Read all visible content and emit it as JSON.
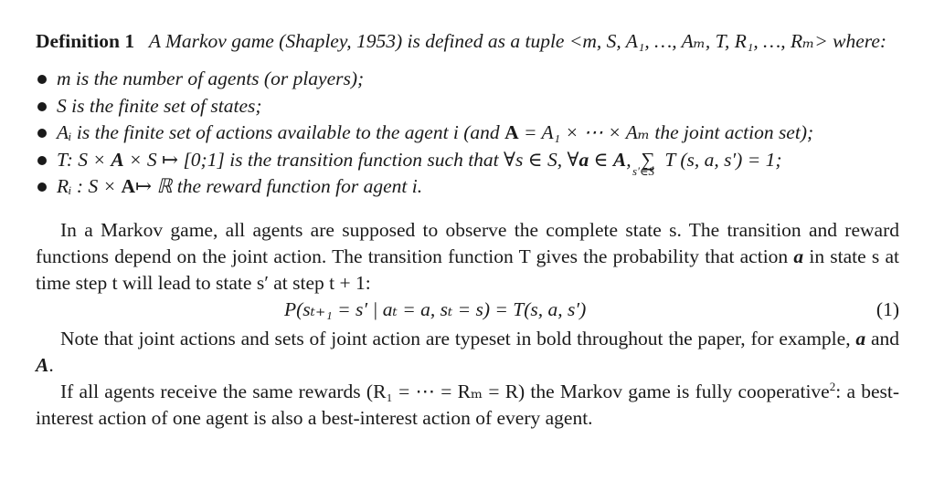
{
  "definition": {
    "label": "Definition 1",
    "line1": "A Markov game (Shapley, 1953) is defined as a tuple <m, S, A₁, …, Aₘ, T,",
    "line2": "R₁, …, Rₘ> where:"
  },
  "bullets": [
    {
      "text": "m is the number of agents (or players);"
    },
    {
      "text": "S is the finite set of states;"
    },
    {
      "text_before": "Aᵢ is the finite set of actions available to the agent i (and ",
      "bold": "A",
      "text_after": " = A₁ × ⋯ × Aₘ the joint action set);"
    },
    {
      "text_before": "T: S × ",
      "bold1": "A",
      "text_mid": " × S ↦ [0;1] is the transition function such that ∀s ∈ S, ∀",
      "bold2": "a",
      "text_mid2": " ∈ ",
      "bold3": "A",
      "text_mid3": ",",
      "sum": "∑",
      "sum_sub": "s′∈S",
      "text_after": "T (s, a, s′) = 1;"
    },
    {
      "text_before": "Rᵢ : S × ",
      "bold": "A",
      "text_after": "↦ ℝ the reward function for agent i."
    }
  ],
  "paragraphs": {
    "p1_before_a": "In a Markov game, all agents are supposed to observe the complete state s. The transition and reward functions depend on the joint action. The transition function T gives the probability that action ",
    "p1_a": "a",
    "p1_after_a": " in state s at time step t will lead to state s′ at step t + 1:",
    "equation": "P(sₜ₊₁ = s′ | aₜ = a, sₜ = s) = T(s, a, s′)",
    "equation_number": "(1)",
    "p2_before": "Note that joint actions and sets of joint action are typeset in bold throughout the paper, for example, ",
    "p2_a": "a",
    "p2_and": " and ",
    "p2_A": "A",
    "p2_end": ".",
    "p3_before": "If all agents receive the same rewards (R₁ = ⋯ = Rₘ = R) the Markov game is fully cooperative",
    "p3_footnote": "2",
    "p3_after": ": a best-interest action of one agent is also a best-interest action of every agent."
  }
}
